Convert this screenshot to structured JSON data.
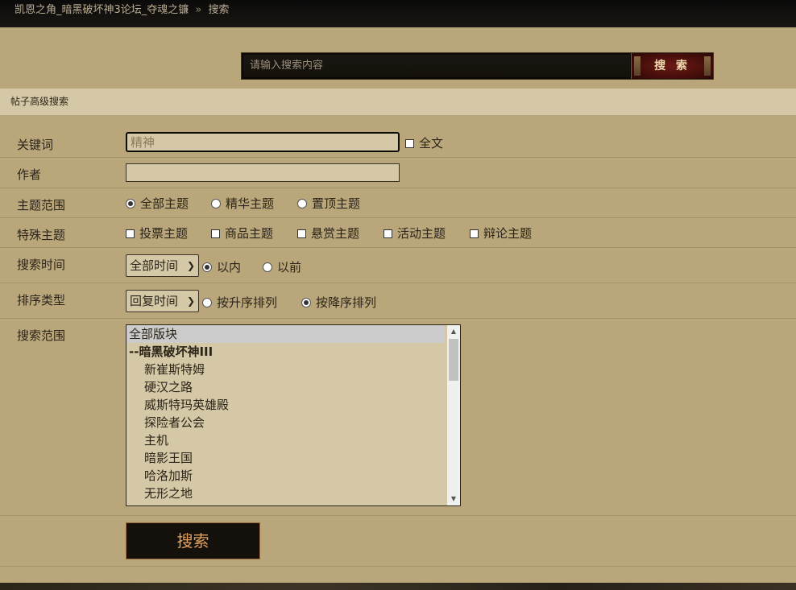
{
  "breadcrumb": {
    "forum": "凯恩之角_暗黑破坏神3论坛_夺魂之镰",
    "separator": "»",
    "current": "搜索"
  },
  "top_search": {
    "placeholder": "请输入搜索内容",
    "button_label": "搜 索"
  },
  "section_title": "帖子高级搜索",
  "form": {
    "keyword": {
      "label": "关键词",
      "value": "精神",
      "fulltext_label": "全文"
    },
    "author": {
      "label": "作者",
      "value": ""
    },
    "topic_scope": {
      "label": "主题范围",
      "options": [
        "全部主题",
        "精华主题",
        "置顶主题"
      ],
      "selected": "全部主题"
    },
    "special_topics": {
      "label": "特殊主题",
      "options": [
        "投票主题",
        "商品主题",
        "悬赏主题",
        "活动主题",
        "辩论主题"
      ]
    },
    "search_time": {
      "label": "搜索时间",
      "select_value": "全部时间",
      "radios": [
        "以内",
        "以前"
      ],
      "selected": "以内"
    },
    "sort_type": {
      "label": "排序类型",
      "select_value": "回复时间",
      "radios": [
        "按升序排列",
        "按降序排列"
      ],
      "selected": "按降序排列"
    },
    "search_range": {
      "label": "搜索范围",
      "items": [
        {
          "text": "全部版块",
          "kind": "selected"
        },
        {
          "text": "--暗黑破坏神III",
          "kind": "cat"
        },
        {
          "text": "新崔斯特姆",
          "kind": "sub"
        },
        {
          "text": "硬汉之路",
          "kind": "sub"
        },
        {
          "text": "威斯特玛英雄殿",
          "kind": "sub"
        },
        {
          "text": "探险者公会",
          "kind": "sub"
        },
        {
          "text": "主机",
          "kind": "sub"
        },
        {
          "text": "暗影王国",
          "kind": "sub"
        },
        {
          "text": "哈洛加斯",
          "kind": "sub"
        },
        {
          "text": "无形之地",
          "kind": "sub"
        }
      ]
    },
    "submit_label": "搜索"
  },
  "colors": {
    "page_bg": "#b9a67a",
    "header_bg": "#d4c8a6",
    "submit_text": "#e39f5c"
  },
  "icons": [
    "scroll-up-arrow-icon",
    "scroll-down-arrow-icon",
    "select-chevron-icon"
  ]
}
